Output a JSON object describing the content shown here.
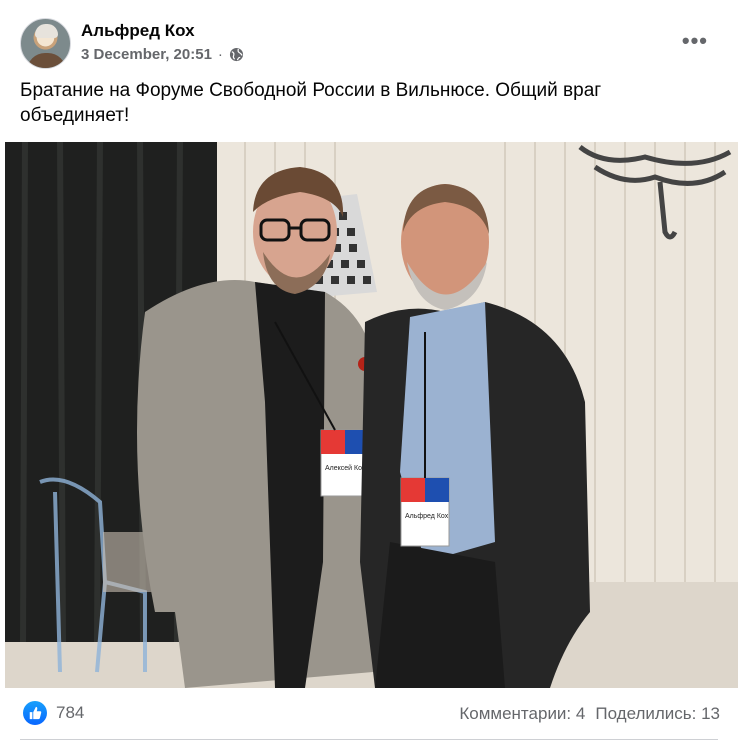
{
  "post": {
    "author": "Альфред Кох",
    "date": "3 December, 20:51",
    "separator": "·",
    "text": "Братание на Форуме Свободной России в Вильнюсе. Общий враг объединяет!",
    "privacy_icon": "globe-icon",
    "more_icon": "more-options-icon"
  },
  "photo": {
    "description_icon": "photo",
    "badge_left": "Алексей Кононов",
    "badge_right": "Альфред Кох"
  },
  "reactions": {
    "icon": "like-icon",
    "count": "784",
    "comments": "Комментарии: 4",
    "shares": "Поделились: 13"
  },
  "colors": {
    "accent": "#0866ff",
    "secondary_text": "#65676b"
  }
}
